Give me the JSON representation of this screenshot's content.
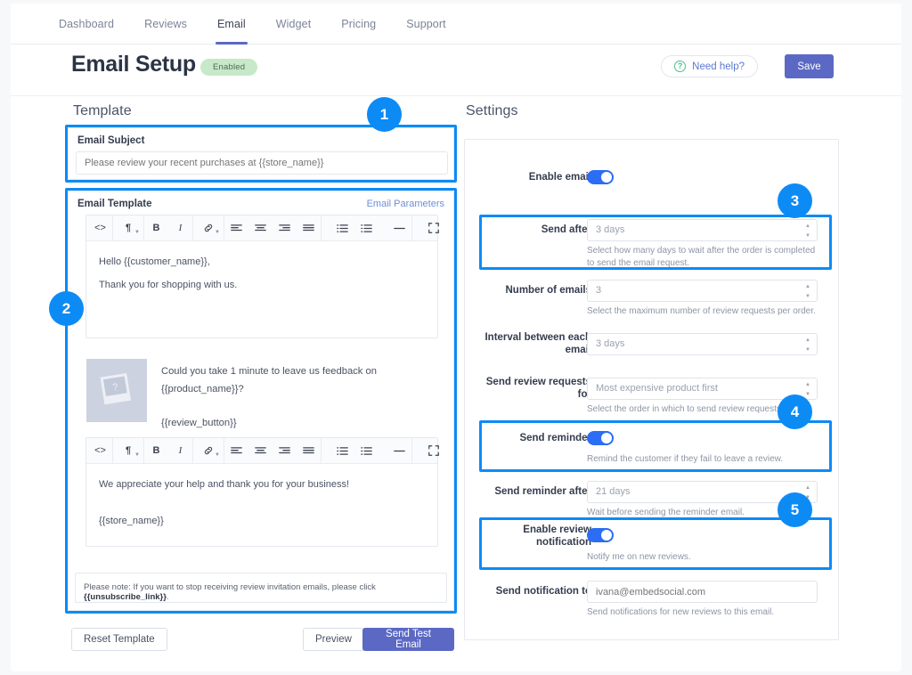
{
  "nav": {
    "items": [
      {
        "label": "Dashboard",
        "active": false
      },
      {
        "label": "Reviews",
        "active": false
      },
      {
        "label": "Email",
        "active": true
      },
      {
        "label": "Widget",
        "active": false
      },
      {
        "label": "Pricing",
        "active": false
      },
      {
        "label": "Support",
        "active": false
      }
    ]
  },
  "header": {
    "title": "Email Setup",
    "status_pill": "Enabled",
    "need_help_label": "Need help?",
    "need_help_icon": "question-circle-icon",
    "save_label": "Save",
    "accent_color": "#5b69c4",
    "pill_color": "#c7e9c9"
  },
  "template": {
    "section_label": "Template",
    "subject": {
      "card_title": "Email Subject",
      "value": "Please review your recent purchases at {{store_name}}",
      "placeholder": "Please review your recent purchases at {{store_name}}"
    },
    "editor": {
      "card_title": "Email Template",
      "parameters_link": "Email Parameters",
      "toolbar_icons": [
        "code-icon",
        "paragraph-format-icon",
        "bold-icon",
        "italic-icon",
        "link-icon",
        "align-left-icon",
        "align-center-icon",
        "align-right-icon",
        "align-justify-icon",
        "ordered-list-icon",
        "unordered-list-icon",
        "horizontal-rule-icon",
        "fullscreen-icon"
      ],
      "body_top_line1": "Hello {{customer_name}},",
      "body_top_line2": "Thank you for shopping with us.",
      "promo_text": "Could you take 1 minute to leave us feedback on {{product_name}}?",
      "promo_button_token": "{{review_button}}",
      "promo_image_icon": "photo-placeholder-icon",
      "body_bottom_line1": "We appreciate your help and thank you for your business!",
      "body_bottom_line2": "{{store_name}}"
    },
    "note_prefix": "Please note: If you want to stop receiving review invitation emails, please click ",
    "note_token": "{{unsubscribe_link}}",
    "note_suffix": ".",
    "buttons": {
      "reset": "Reset Template",
      "preview": "Preview",
      "send_test": "Send Test Email"
    }
  },
  "settings": {
    "section_label": "Settings",
    "rows": [
      {
        "key": "enable_email",
        "label": "Enable email",
        "type": "toggle",
        "value": "on",
        "help": ""
      },
      {
        "key": "send_after",
        "label": "Send after",
        "type": "select",
        "value": "3 days",
        "help": "Select how many days to wait after the order is completed to send the email request."
      },
      {
        "key": "number_of_emails",
        "label": "Number of emails",
        "type": "select",
        "value": "3",
        "help": "Select the maximum number of review requests per order."
      },
      {
        "key": "interval_between_each_email",
        "label": "Interval between each email",
        "type": "select",
        "value": "3 days",
        "help": ""
      },
      {
        "key": "send_review_requests_for",
        "label": "Send review requests for",
        "type": "select",
        "value": "Most expensive product first",
        "help": "Select the order in which to send review requests."
      },
      {
        "key": "send_reminder",
        "label": "Send reminder",
        "type": "toggle",
        "value": "on",
        "help": "Remind the customer if they fail to leave a review."
      },
      {
        "key": "send_reminder_after",
        "label": "Send reminder after",
        "type": "select",
        "value": "21 days",
        "help": "Wait before sending the reminder email."
      },
      {
        "key": "enable_review_notification",
        "label": "Enable review notification",
        "type": "toggle",
        "value": "on",
        "help": "Notify me on new reviews."
      },
      {
        "key": "send_notification_to",
        "label": "Send notification to",
        "type": "text",
        "value": "ivana@embedsocial.com",
        "help": "Send notifications for new reviews to this email."
      }
    ]
  },
  "annotations": {
    "color": "#0d8bf5",
    "badges": [
      {
        "number": "1",
        "target": "email-subject-card"
      },
      {
        "number": "2",
        "target": "email-template-card"
      },
      {
        "number": "3",
        "target": "send-after-row"
      },
      {
        "number": "4",
        "target": "send-reminder-row"
      },
      {
        "number": "5",
        "target": "enable-review-notification-row"
      }
    ]
  }
}
